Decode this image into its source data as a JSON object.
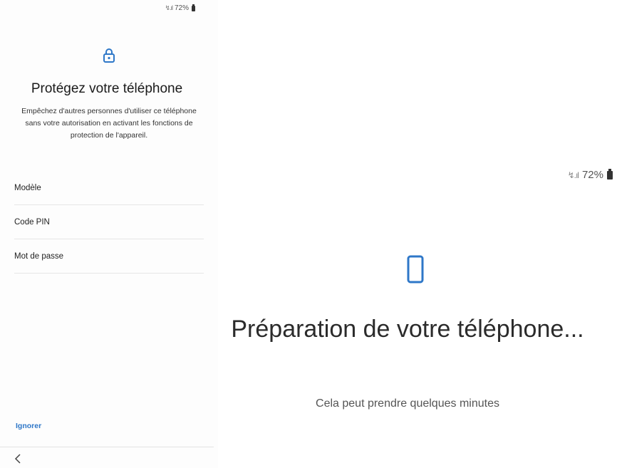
{
  "left_screen": {
    "status_bar": {
      "signal": "↯.ıl",
      "battery_percent": "72%"
    },
    "header_icon": "lock-icon",
    "title": "Protégez votre téléphone",
    "description": "Empêchez d'autres personnes d'utiliser ce téléphone sans votre autorisation en activant les fonctions de protection de l'appareil.",
    "options": [
      {
        "label": "Modèle"
      },
      {
        "label": "Code PIN"
      },
      {
        "label": "Mot de passe"
      }
    ],
    "skip_label": "Ignorer",
    "back_icon": "chevron-left-icon"
  },
  "right_screen": {
    "status_bar": {
      "signal": "↯.ıl",
      "battery_percent": "72%"
    },
    "header_icon": "phone-icon",
    "title": "Préparation de votre téléphone...",
    "subtitle": "Cela peut prendre quelques minutes"
  },
  "colors": {
    "accent": "#2e77c8",
    "text_primary": "#1a1a1a",
    "divider": "#e6e6e6"
  }
}
